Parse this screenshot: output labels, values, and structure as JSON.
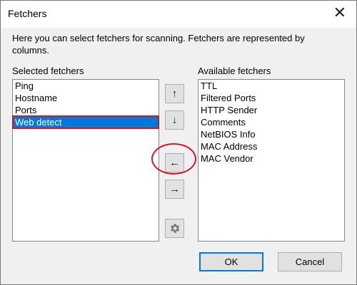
{
  "window": {
    "title": "Fetchers",
    "close_icon": "close-icon"
  },
  "intro_text": "Here you can select fetchers for scanning. Fetchers are represented by columns.",
  "selected": {
    "label": "Selected fetchers",
    "items": [
      "Ping",
      "Hostname",
      "Ports",
      "Web detect"
    ],
    "selected_item": "Web detect"
  },
  "available": {
    "label": "Available fetchers",
    "items": [
      "TTL",
      "Filtered Ports",
      "HTTP Sender",
      "Comments",
      "NetBIOS Info",
      "MAC Address",
      "MAC Vendor"
    ]
  },
  "controls": {
    "up": "↑",
    "down": "↓",
    "left": "←",
    "right": "→",
    "settings_icon": "gear-icon"
  },
  "footer": {
    "ok_label": "OK",
    "cancel_label": "Cancel"
  },
  "colors": {
    "selection": "#0078d7",
    "highlight": "#d0142a"
  }
}
